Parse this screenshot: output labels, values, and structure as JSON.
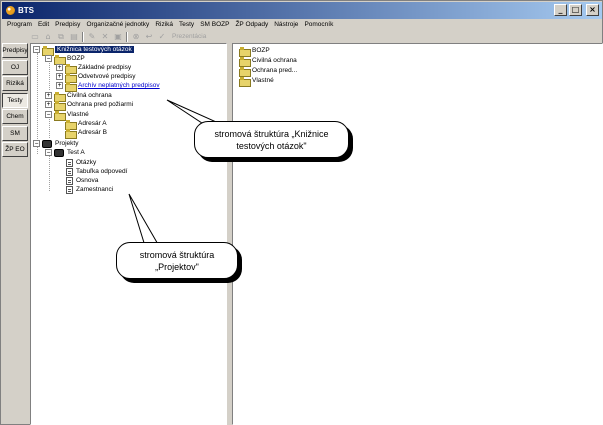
{
  "window": {
    "title": "BTS"
  },
  "title_buttons": [
    "_",
    "□",
    "×"
  ],
  "menu": [
    "Program",
    "Edit",
    "Predpisy",
    "Organizačné jednotky",
    "Riziká",
    "Testy",
    "SM BOZP",
    "ŽP Odpady",
    "Nástroje",
    "Pomocník"
  ],
  "toolbar": {
    "icons": [
      "new-icon",
      "open-icon",
      "copy-icon",
      "paste-icon",
      "edit-icon",
      "delete-icon",
      "save-icon",
      "cancel-icon",
      "undo-icon",
      "check-icon"
    ],
    "presentation_label": "Prezentácia"
  },
  "sidebar": {
    "tabs": [
      "Predpisy",
      "OJ",
      "Riziká",
      "Testy",
      "Chem",
      "SM",
      "ŽP EO"
    ],
    "active": "Testy"
  },
  "tree": {
    "root_label": "Knižnica testových otázok",
    "bozp": "BOZP",
    "bozp_children": [
      "Základné predpisy",
      "Odvetvové predpisy",
      "Archív neplatných predpisov"
    ],
    "civil": "Civilná ochrana",
    "fire": "Ochrana pred požiarmi",
    "own": "Vlastné",
    "own_children": [
      "Adresár A",
      "Adresár B"
    ],
    "projects": "Projekty",
    "test_a": "Test A",
    "test_children": [
      "Otázky",
      "Tabuľka odpovedí",
      "Osnova",
      "Zamestnanci"
    ]
  },
  "right_list": [
    "BOZP",
    "Civilná ochrana",
    "Ochrana pred...",
    "Vlastné"
  ],
  "callouts": {
    "top": "stromová štruktúra „Knižnice testových otázok\"",
    "bottom": "stromová štruktúra „Projektov\""
  }
}
